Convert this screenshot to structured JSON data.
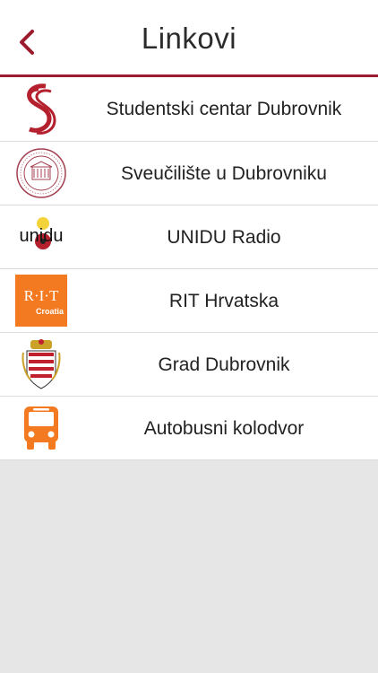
{
  "header": {
    "title": "Linkovi",
    "back_icon": "chevron-left-icon"
  },
  "links": [
    {
      "label": "Studentski centar Dubrovnik",
      "icon": "studentski-centar-logo-icon"
    },
    {
      "label": "Sveučilište u Dubrovniku",
      "icon": "university-seal-icon"
    },
    {
      "label": "UNIDU Radio",
      "icon": "unidu-radio-logo-icon"
    },
    {
      "label": "RIT Hrvatska",
      "icon": "rit-croatia-logo-icon"
    },
    {
      "label": "Grad Dubrovnik",
      "icon": "dubrovnik-coat-of-arms-icon"
    },
    {
      "label": "Autobusni kolodvor",
      "icon": "bus-icon"
    }
  ],
  "logo_text": {
    "rit": "R·I·T",
    "rit_sub": "Croatia",
    "unidu": "unidu"
  },
  "colors": {
    "accent": "#9c1c2f",
    "bus": "#f37a21",
    "rit": "#f37a21",
    "background": "#e6e6e6"
  }
}
